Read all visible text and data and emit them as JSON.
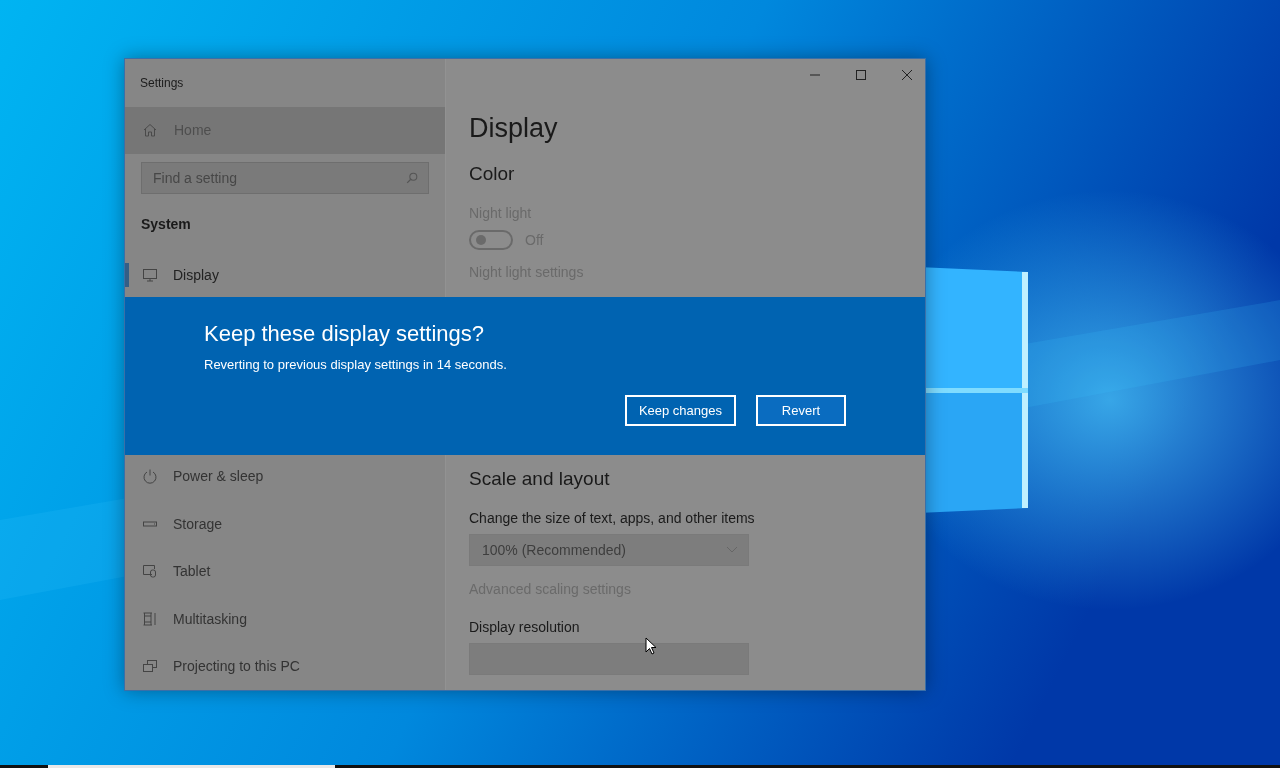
{
  "window": {
    "title": "Settings"
  },
  "sidebar": {
    "home": {
      "label": "Home"
    },
    "search": {
      "placeholder": "Find a setting"
    },
    "section": "System",
    "items": [
      {
        "label": "Display",
        "selected": true
      },
      {
        "label": "Power & sleep",
        "selected": false
      },
      {
        "label": "Storage",
        "selected": false
      },
      {
        "label": "Tablet",
        "selected": false
      },
      {
        "label": "Multitasking",
        "selected": false
      },
      {
        "label": "Projecting to this PC",
        "selected": false
      }
    ]
  },
  "content": {
    "title": "Display",
    "color_section": {
      "heading": "Color",
      "night_light": {
        "label": "Night light",
        "on": false,
        "state_text": "Off",
        "disabled": true
      },
      "link": "Night light settings"
    },
    "scale_section": {
      "heading": "Scale and layout",
      "size_label": "Change the size of text, apps, and other items",
      "size_value": "100% (Recommended)",
      "disabled": true,
      "advanced_link": "Advanced scaling settings",
      "resolution_label": "Display resolution"
    }
  },
  "dialog": {
    "title": "Keep these display settings?",
    "message": "Reverting to previous display settings in 14 seconds.",
    "buttons": [
      {
        "label": "Keep changes"
      },
      {
        "label": "Revert"
      }
    ]
  }
}
